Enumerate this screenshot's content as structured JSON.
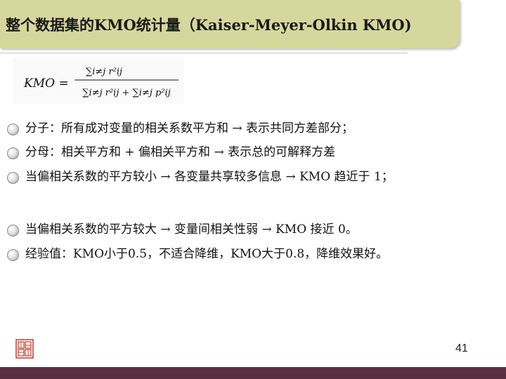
{
  "slide": {
    "title": "整个数据集的KMO统计量（Kaiser-Meyer-Olkin KMO)",
    "formula": {
      "lhs": "KMO =",
      "numerator": "∑i≠j r²ij",
      "denominator": "∑i≠j r²ij + ∑i≠j p²ij"
    },
    "bullets": [
      "分子：所有成对变量的相关系数平方和 → 表示共同方差部分；",
      "分母：相关平方和 + 偏相关平方和 → 表示总的可解释方差",
      "当偏相关系数的平方较小 → 各变量共享较多信息 → KMO 趋近于 1；",
      "当偏相关系数的平方较大 → 变量间相关性弱 → KMO 接近 0。",
      "经验值：KMO小于0.5，不适合降维，KMO大于0.8，降维效果好。"
    ],
    "page_number": "41"
  },
  "colors": {
    "title_bar": "#d6d79c",
    "footer_bar": "#5b2f42",
    "seal": "#c0392b"
  },
  "icons": [
    "bullet-dot-icon",
    "seal-logo"
  ]
}
